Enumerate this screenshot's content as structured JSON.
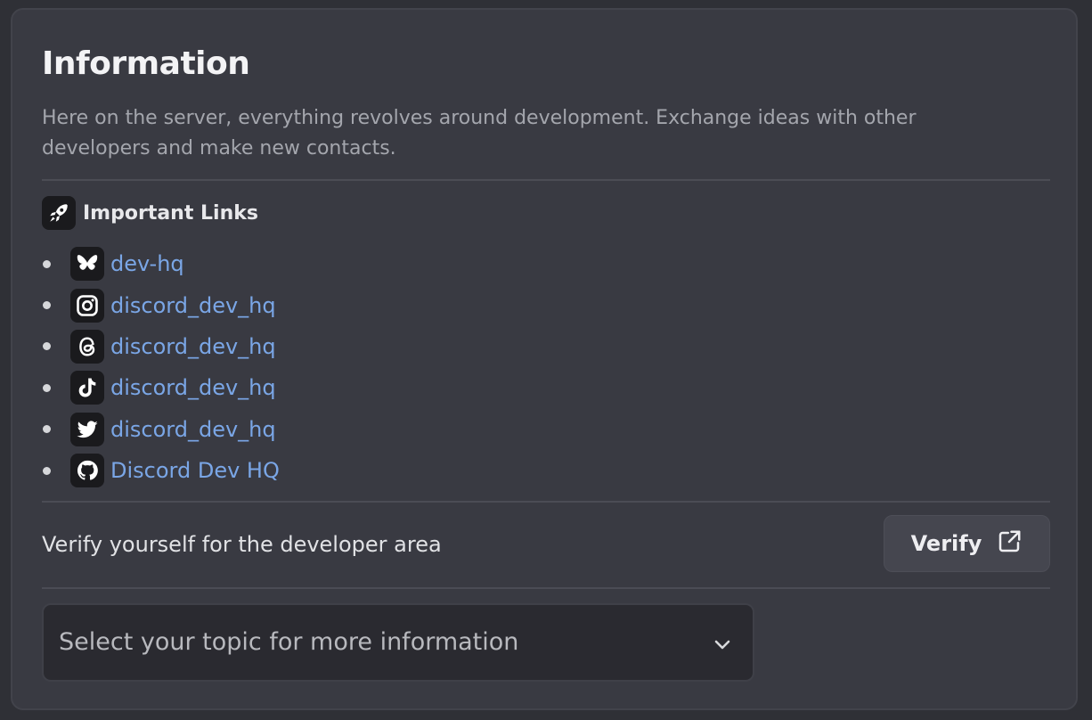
{
  "info": {
    "title": "Information",
    "description": "Here on the server, everything revolves around development. Exchange ideas with other developers and make new contacts."
  },
  "links_section": {
    "heading": "Important Links",
    "heading_icon": "rocket-icon",
    "items": [
      {
        "label": "dev-hq",
        "icon": "bluesky-butterfly-icon"
      },
      {
        "label": "discord_dev_hq",
        "icon": "instagram-icon"
      },
      {
        "label": "discord_dev_hq",
        "icon": "threads-icon"
      },
      {
        "label": "discord_dev_hq",
        "icon": "tiktok-icon"
      },
      {
        "label": "discord_dev_hq",
        "icon": "twitter-bird-icon"
      },
      {
        "label": "Discord Dev HQ",
        "icon": "github-icon"
      }
    ]
  },
  "verify": {
    "text": "Verify yourself for the developer area",
    "button_label": "Verify",
    "button_icon": "external-link-icon"
  },
  "topic_select": {
    "placeholder": "Select your topic for more information",
    "icon": "chevron-down-icon"
  },
  "colors": {
    "background": "#393a42",
    "link": "#7aa6e6",
    "text_muted": "#a4a6ad",
    "button_bg": "#45464f"
  }
}
